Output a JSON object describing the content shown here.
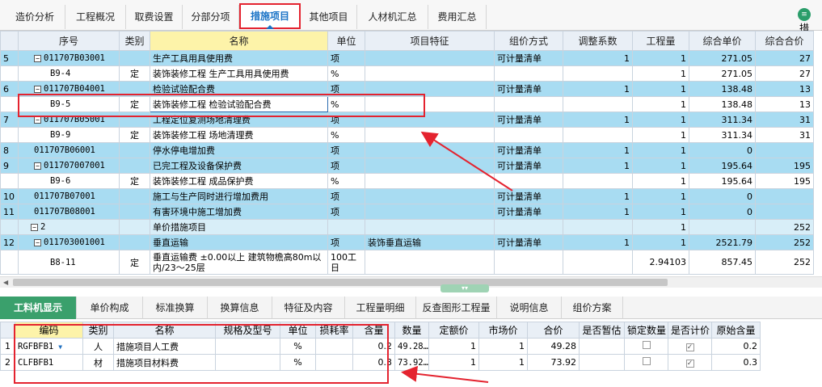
{
  "tabs": [
    "造价分析",
    "工程概况",
    "取费设置",
    "分部分项",
    "措施项目",
    "其他项目",
    "人材机汇总",
    "费用汇总"
  ],
  "active_tab": "措施项目",
  "top_right_icon": "report-icon",
  "top_right_label": "措",
  "colors": {
    "accent": "#1a73c6",
    "row_blue": "#a8dcf2",
    "highlight": "#e4232f",
    "tab_green": "#3aa06c"
  },
  "main_grid": {
    "headers": [
      "",
      "序号",
      "类别",
      "名称",
      "单位",
      "项目特征",
      "组价方式",
      "调整系数",
      "工程量",
      "综合单价",
      "综合合价"
    ],
    "rows": [
      {
        "idx": "5",
        "code": "011707B03001",
        "type": "",
        "name": "生产工具用具使用费",
        "unit": "项",
        "feature": "",
        "method": "可计量清单",
        "coef": "1",
        "qty": "1",
        "price": "271.05",
        "total": "27",
        "kind": "blue",
        "level": 1,
        "toggle": "−"
      },
      {
        "idx": "",
        "code": "B9-4",
        "type": "定",
        "name": "装饰装修工程 生产工具用具使用费",
        "unit": "%",
        "feature": "",
        "method": "",
        "coef": "",
        "qty": "1",
        "price": "271.05",
        "total": "27",
        "kind": "sub",
        "level": 2,
        "toggle": ""
      },
      {
        "idx": "6",
        "code": "011707B04001",
        "type": "",
        "name": "检验试验配合费",
        "unit": "项",
        "feature": "",
        "method": "可计量清单",
        "coef": "1",
        "qty": "1",
        "price": "138.48",
        "total": "13",
        "kind": "blue",
        "level": 1,
        "toggle": "−"
      },
      {
        "idx": "",
        "code": "B9-5",
        "type": "定",
        "name": "装饰装修工程 检验试验配合费",
        "unit": "%",
        "feature": "",
        "method": "",
        "coef": "",
        "qty": "1",
        "price": "138.48",
        "total": "13",
        "kind": "sub",
        "level": 2,
        "toggle": "",
        "selected": true
      },
      {
        "idx": "7",
        "code": "011707B05001",
        "type": "",
        "name": "工程定位复测场地清理费",
        "unit": "项",
        "feature": "",
        "method": "可计量清单",
        "coef": "1",
        "qty": "1",
        "price": "311.34",
        "total": "31",
        "kind": "blue",
        "level": 1,
        "toggle": "−"
      },
      {
        "idx": "",
        "code": "B9-9",
        "type": "定",
        "name": "装饰装修工程 场地清理费",
        "unit": "%",
        "feature": "",
        "method": "",
        "coef": "",
        "qty": "1",
        "price": "311.34",
        "total": "31",
        "kind": "sub",
        "level": 2,
        "toggle": ""
      },
      {
        "idx": "8",
        "code": "011707B06001",
        "type": "",
        "name": "停水停电增加费",
        "unit": "项",
        "feature": "",
        "method": "可计量清单",
        "coef": "1",
        "qty": "1",
        "price": "0",
        "total": "",
        "kind": "blue",
        "level": 1,
        "toggle": ""
      },
      {
        "idx": "9",
        "code": "011707007001",
        "type": "",
        "name": "已完工程及设备保护费",
        "unit": "项",
        "feature": "",
        "method": "可计量清单",
        "coef": "1",
        "qty": "1",
        "price": "195.64",
        "total": "195",
        "kind": "blue",
        "level": 1,
        "toggle": "−"
      },
      {
        "idx": "",
        "code": "B9-6",
        "type": "定",
        "name": "装饰装修工程 成品保护费",
        "unit": "%",
        "feature": "",
        "method": "",
        "coef": "",
        "qty": "1",
        "price": "195.64",
        "total": "195",
        "kind": "sub",
        "level": 2,
        "toggle": ""
      },
      {
        "idx": "10",
        "code": "011707B07001",
        "type": "",
        "name": "施工与生产同时进行增加费用",
        "unit": "项",
        "feature": "",
        "method": "可计量清单",
        "coef": "1",
        "qty": "1",
        "price": "0",
        "total": "",
        "kind": "blue",
        "level": 1,
        "toggle": ""
      },
      {
        "idx": "11",
        "code": "011707B08001",
        "type": "",
        "name": "有害环境中施工增加费",
        "unit": "项",
        "feature": "",
        "method": "可计量清单",
        "coef": "1",
        "qty": "1",
        "price": "0",
        "total": "",
        "kind": "blue",
        "level": 1,
        "toggle": ""
      },
      {
        "idx": "",
        "code": "2",
        "type": "",
        "name": "单价措施项目",
        "unit": "",
        "feature": "",
        "method": "",
        "coef": "",
        "qty": "1",
        "price": "",
        "total": "252",
        "kind": "grp",
        "level": 0,
        "toggle": "−"
      },
      {
        "idx": "12",
        "code": "011703001001",
        "type": "",
        "name": "垂直运输",
        "unit": "项",
        "feature": "装饰垂直运输",
        "method": "可计量清单",
        "coef": "1",
        "qty": "1",
        "price": "2521.79",
        "total": "252",
        "kind": "blue",
        "level": 1,
        "toggle": "−"
      },
      {
        "idx": "",
        "code": "B8-11",
        "type": "定",
        "name": "垂直运输费 ±0.00以上 建筑物檐高80m以内/23～25层",
        "unit": "100工日",
        "feature": "",
        "method": "",
        "coef": "",
        "qty": "2.94103",
        "price": "857.45",
        "total": "252",
        "kind": "sub",
        "level": 2,
        "toggle": "",
        "tall": true
      }
    ]
  },
  "bottom_tabs": [
    "工料机显示",
    "单价构成",
    "标准换算",
    "换算信息",
    "特征及内容",
    "工程量明细",
    "反查图形工程量",
    "说明信息",
    "组价方案"
  ],
  "active_bottom_tab": "工料机显示",
  "bottom_grid": {
    "headers": [
      "",
      "编码",
      "类别",
      "名称",
      "规格及型号",
      "单位",
      "损耗率",
      "含量",
      "数量",
      "定额价",
      "市场价",
      "合价",
      "是否暂估",
      "锁定数量",
      "是否计价",
      "原始含量"
    ],
    "rows": [
      {
        "n": "1",
        "code": "RGFBFB1",
        "type": "人",
        "name": "措施项目人工费",
        "spec": "",
        "unit": "%",
        "loss": "",
        "content": "0.2",
        "amount": "49.28…",
        "quota": "1",
        "market": "1",
        "total": "49.28",
        "temp": "",
        "locked": false,
        "priced": true,
        "orig": "0.2"
      },
      {
        "n": "2",
        "code": "CLFBFB1",
        "type": "材",
        "name": "措施项目材料费",
        "spec": "",
        "unit": "%",
        "loss": "",
        "content": "0.3",
        "amount": "73.92…",
        "quota": "1",
        "market": "1",
        "total": "73.92",
        "temp": "",
        "locked": false,
        "priced": true,
        "orig": "0.3"
      }
    ]
  }
}
